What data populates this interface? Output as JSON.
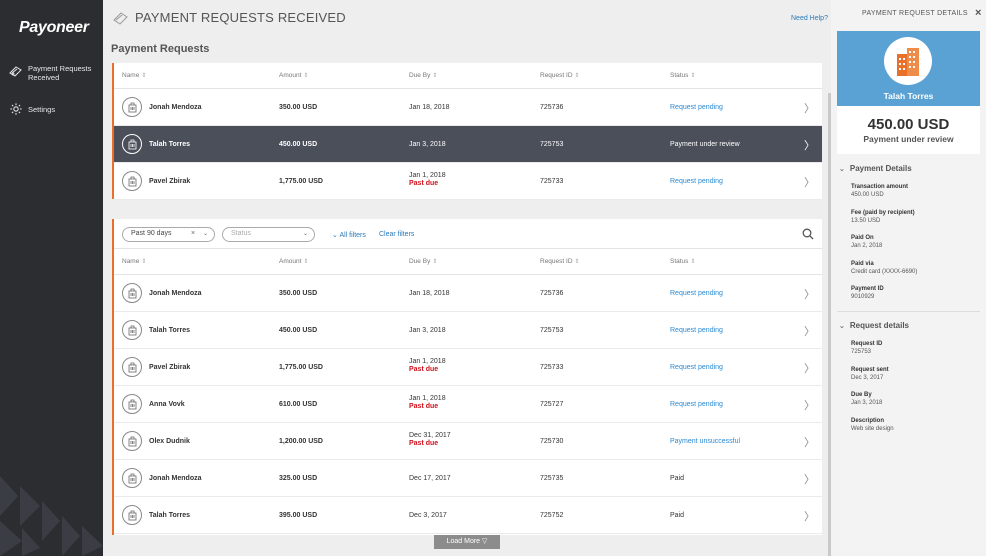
{
  "app": {
    "logo": "Payoneer",
    "title": "PAYMENT REQUESTS RECEIVED",
    "help": "Need Help?"
  },
  "sidebar": {
    "items": [
      {
        "label_line1": "Payment Requests",
        "label_line2": "Received",
        "icon": "payment-requests-icon"
      },
      {
        "label": "Settings",
        "icon": "gear-icon"
      }
    ]
  },
  "section_title": "Payment Requests",
  "columns": {
    "name": "Name",
    "amount": "Amount",
    "due": "Due By",
    "id": "Request ID",
    "status": "Status"
  },
  "top_rows": [
    {
      "name": "Jonah Mendoza",
      "amount": "350.00 USD",
      "due": "Jan 18, 2018",
      "past": "",
      "id": "725736",
      "status": "Request pending",
      "status_type": "pending"
    },
    {
      "name": "Talah Torres",
      "amount": "450.00 USD",
      "due": "Jan 3, 2018",
      "past": "",
      "id": "725753",
      "status": "Payment under review",
      "status_type": "selected"
    },
    {
      "name": "Pavel Zbirak",
      "amount": "1,775.00 USD",
      "due": "Jan 1, 2018",
      "past": "Past due",
      "id": "725733",
      "status": "Request pending",
      "status_type": "pending"
    }
  ],
  "filters": {
    "period": "Past 90 days",
    "status_placeholder": "Status",
    "all_filters": "All filters",
    "clear_filters": "Clear filters"
  },
  "rows": [
    {
      "name": "Jonah Mendoza",
      "amount": "350.00 USD",
      "due": "Jan 18, 2018",
      "past": "",
      "id": "725736",
      "status": "Request pending",
      "status_type": "pending"
    },
    {
      "name": "Talah Torres",
      "amount": "450.00 USD",
      "due": "Jan 3, 2018",
      "past": "",
      "id": "725753",
      "status": "Request pending",
      "status_type": "pending"
    },
    {
      "name": "Pavel Zbirak",
      "amount": "1,775.00 USD",
      "due": "Jan 1, 2018",
      "past": "Past due",
      "id": "725733",
      "status": "Request pending",
      "status_type": "pending"
    },
    {
      "name": "Anna Vovk",
      "amount": "610.00 USD",
      "due": "Jan 1, 2018",
      "past": "Past due",
      "id": "725727",
      "status": "Request pending",
      "status_type": "pending"
    },
    {
      "name": "Olex Dudnik",
      "amount": "1,200.00 USD",
      "due": "Dec 31, 2017",
      "past": "Past due",
      "id": "725730",
      "status": "Payment unsuccessful",
      "status_type": "pending"
    },
    {
      "name": "Jonah Mendoza",
      "amount": "325.00 USD",
      "due": "Dec 17, 2017",
      "past": "",
      "id": "725735",
      "status": "Paid",
      "status_type": "paid"
    },
    {
      "name": "Talah Torres",
      "amount": "395.00 USD",
      "due": "Dec 3, 2017",
      "past": "",
      "id": "725752",
      "status": "Paid",
      "status_type": "paid"
    }
  ],
  "load_more": "Load More",
  "details": {
    "title": "PAYMENT REQUEST DETAILS",
    "close": "×",
    "name": "Talah Torres",
    "amount": "450.00 USD",
    "status": "Payment under review",
    "payment_section": "Payment Details",
    "payment_fields": [
      {
        "k": "Transaction amount",
        "v": "450.00 USD"
      },
      {
        "k": "Fee (paid by recipient)",
        "v": "13.50 USD"
      },
      {
        "k": "Paid On",
        "v": "Jan 2, 2018"
      },
      {
        "k": "Paid via",
        "v": "Credit card (XXXX-6690)"
      },
      {
        "k": "Payment ID",
        "v": "9010929"
      }
    ],
    "request_section": "Request details",
    "request_fields": [
      {
        "k": "Request ID",
        "v": "725753"
      },
      {
        "k": "Request sent",
        "v": "Dec 3, 2017"
      },
      {
        "k": "Due By",
        "v": "Jan 3, 2018"
      },
      {
        "k": "Description",
        "v": "Web site design"
      }
    ]
  },
  "colors": {
    "accent": "#e8702a",
    "link": "#2a8ad4",
    "selected_row": "#4b4f59",
    "panel_blue": "#5aa2d4",
    "past_due": "#d0111b"
  }
}
